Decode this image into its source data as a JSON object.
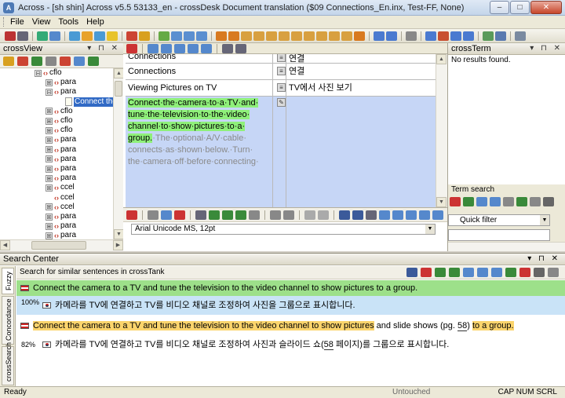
{
  "window": {
    "app_icon": "A",
    "title": "Across - [sh shin] Across v5.5 53133_en - crossDesk Document translation ($09 Connections_En.inx, Test-FF, None)",
    "minimize": "–",
    "maximize": "□",
    "close": "✕"
  },
  "menu": {
    "file": "File",
    "view": "View",
    "tools": "Tools",
    "help": "Help"
  },
  "crossview": {
    "title": "crossView",
    "controls": "▾ ⊓ ✕",
    "tree": [
      {
        "label": "cflo",
        "kind": "tag",
        "expander": "⊟"
      },
      {
        "label": "para",
        "kind": "tag",
        "expander": "⊞"
      },
      {
        "label": "para",
        "kind": "tag",
        "expander": "⊟"
      },
      {
        "label": "Connect the",
        "kind": "doc",
        "expander": ""
      },
      {
        "label": "cflo",
        "kind": "tag",
        "expander": "⊞"
      },
      {
        "label": "cflo",
        "kind": "tag",
        "expander": "⊞"
      },
      {
        "label": "cflo",
        "kind": "tag",
        "expander": "⊞"
      },
      {
        "label": "para",
        "kind": "tag",
        "expander": "⊞"
      },
      {
        "label": "para",
        "kind": "tag",
        "expander": "⊞"
      },
      {
        "label": "para",
        "kind": "tag",
        "expander": "⊞"
      },
      {
        "label": "para",
        "kind": "tag",
        "expander": "⊞"
      },
      {
        "label": "para",
        "kind": "tag",
        "expander": "⊞"
      },
      {
        "label": "ccel",
        "kind": "tag",
        "expander": "⊞"
      },
      {
        "label": "ccel",
        "kind": "tag",
        "expander": ""
      },
      {
        "label": "ccel",
        "kind": "tag",
        "expander": "⊞"
      },
      {
        "label": "para",
        "kind": "tag",
        "expander": "⊞"
      },
      {
        "label": "para",
        "kind": "tag",
        "expander": "⊞"
      },
      {
        "label": "para",
        "kind": "tag",
        "expander": "⊞"
      },
      {
        "label": "ccel",
        "kind": "tag",
        "expander": ""
      }
    ]
  },
  "editor": {
    "rows": [
      {
        "source": "Connections",
        "target": "연결"
      },
      {
        "source": "Connections",
        "target": "연결"
      },
      {
        "source": "Viewing Pictures on TV",
        "target": "TV에서 사진 보기"
      }
    ],
    "active_source_hl": "Connect·the·camera·to·a·TV·and· tune·the·television·to·the·video· channel·to·show·pictures·to·a· group.",
    "active_source_dim": "·The·optional·A/V·cable· connects·as·shown·below.·Turn· the·camera·off·before·connecting·",
    "font": "Arial Unicode MS, 12pt"
  },
  "crossterm": {
    "title": "crossTerm",
    "controls": "▾ ⊓ ✕",
    "no_results": "No results found.",
    "term_search_label": "Term search",
    "filter_value": "Quick filter"
  },
  "search_center": {
    "title": "Search Center",
    "controls": "▾ ⊓ ✕",
    "subtitle": "Search for similar sentences in crossTank",
    "tabs": [
      "Fuzzy",
      "Concordance",
      "crossSearch"
    ],
    "results": [
      {
        "source": "Connect the camera to a TV and tune the television to the video channel to show pictures to a group.",
        "match": "100%",
        "target": "카메라를 TV에 연결하고 TV를 비디오 채널로 조정하여 사진을 그룹으로 표시합니다."
      },
      {
        "source_a": "Connect the camera to a TV and tune the television to the video channel to show pictures",
        "source_b": " and slide shows (pg. ",
        "source_c": "58",
        "source_d": ") ",
        "source_e": "to a group.",
        "match": "82%",
        "target_a": "카메라를 TV에 연결하고 TV를 비디오 채널로 조정하여 사진과 슬라이드 쇼(",
        "target_b": "58",
        "target_c": " 페이지)를 그룹으로 표시합니다."
      }
    ]
  },
  "status": {
    "ready": "Ready",
    "state": "Untouched",
    "keys": "CAP  NUM  SCRL"
  },
  "colors": {
    "accent": "#316ac5",
    "exact_match_row": "#9de08a",
    "exact_target_row": "#c9e3f7",
    "fuzzy_highlight": "#fbd46c",
    "active_segment": "#c6d6f6"
  }
}
